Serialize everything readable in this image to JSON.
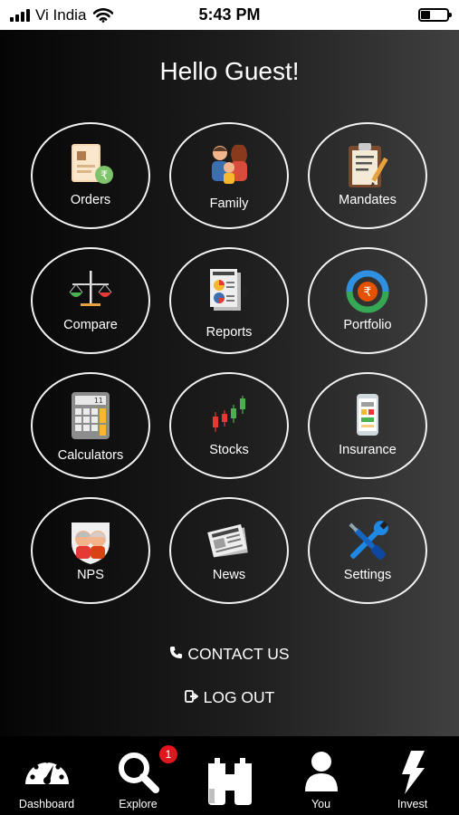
{
  "status_bar": {
    "carrier": "Vi India",
    "time": "5:43 PM"
  },
  "greeting": "Hello Guest!",
  "menu": [
    {
      "label": "Orders",
      "icon": "orders-document-icon"
    },
    {
      "label": "Family",
      "icon": "family-icon"
    },
    {
      "label": "Mandates",
      "icon": "mandates-clipboard-icon"
    },
    {
      "label": "Compare",
      "icon": "compare-scale-icon"
    },
    {
      "label": "Reports",
      "icon": "reports-newspaper-icon"
    },
    {
      "label": "Portfolio",
      "icon": "portfolio-rupee-cycle-icon"
    },
    {
      "label": "Calculators",
      "icon": "calculator-icon"
    },
    {
      "label": "Stocks",
      "icon": "stocks-candlestick-icon"
    },
    {
      "label": "Insurance",
      "icon": "insurance-phone-icon"
    },
    {
      "label": "NPS",
      "icon": "nps-elderly-couple-icon"
    },
    {
      "label": "News",
      "icon": "news-newspaper-icon"
    },
    {
      "label": "Settings",
      "icon": "settings-tools-icon"
    }
  ],
  "links": {
    "contact": "CONTACT US",
    "logout": "LOG OUT"
  },
  "tabbar": {
    "items": [
      {
        "label": "Dashboard",
        "icon": "speedometer-icon"
      },
      {
        "label": "Explore",
        "icon": "magnifier-icon"
      },
      {
        "label": "",
        "icon": "binoculars-icon"
      },
      {
        "label": "You",
        "icon": "person-icon"
      },
      {
        "label": "Invest",
        "icon": "lightning-icon"
      }
    ],
    "explore_badge": "1"
  },
  "colors": {
    "accent_red": "#e0161e",
    "tile_border": "#f2f2f2",
    "status_bg": "#ffffff"
  }
}
